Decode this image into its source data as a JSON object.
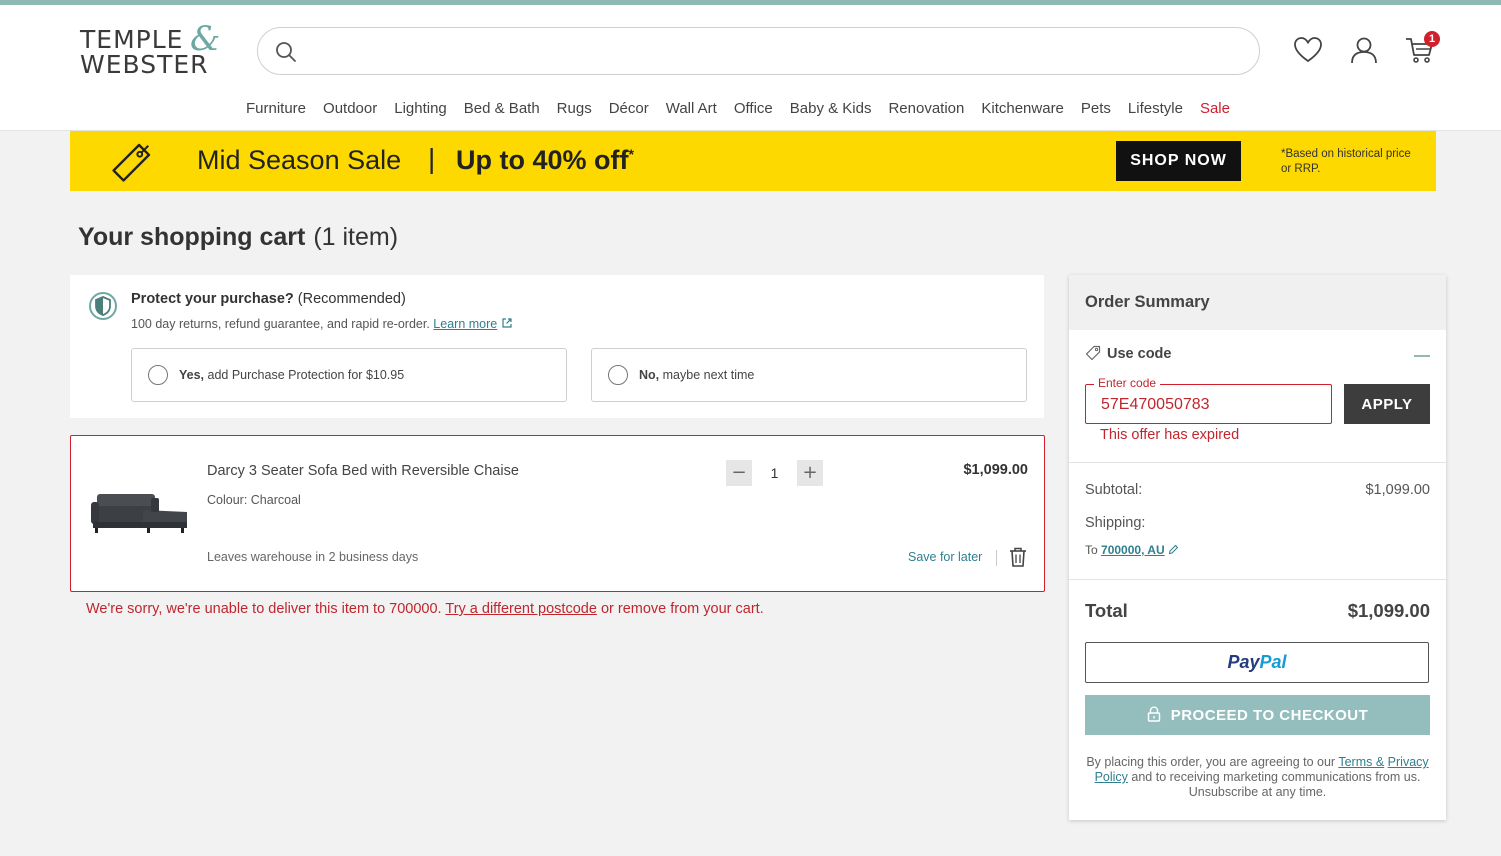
{
  "brand": {
    "line1": "TEMPLE",
    "ampersand": "&",
    "line2": "WEBSTER"
  },
  "search": {
    "placeholder": "",
    "value": ""
  },
  "header_icons": [
    "search-icon",
    "heart-icon",
    "user-icon",
    "cart-icon"
  ],
  "cart_badge": "1",
  "nav": [
    "Furniture",
    "Outdoor",
    "Lighting",
    "Bed & Bath",
    "Rugs",
    "Décor",
    "Wall Art",
    "Office",
    "Baby & Kids",
    "Renovation",
    "Kitchenware",
    "Pets",
    "Lifestyle",
    "Sale"
  ],
  "promo": {
    "title": "Mid Season Sale",
    "separator": "|",
    "offer": "Up to 40% off",
    "offer_mark": "*",
    "button": "SHOP NOW",
    "note": "*Based on historical price or RRP."
  },
  "cart": {
    "title": "Your shopping cart",
    "count": "(1 item)"
  },
  "protection": {
    "title": "Protect your purchase?",
    "recommended": "(Recommended)",
    "description": "100 day returns, refund guarantee, and rapid re-order.",
    "learn_more": "Learn more",
    "yes_bold": "Yes,",
    "yes_rest": "add Purchase Protection for $10.95",
    "no_bold": "No,",
    "no_rest": "maybe next time"
  },
  "item": {
    "name": "Darcy 3 Seater Sofa Bed with Reversible Chaise",
    "colour": "Colour: Charcoal",
    "shipping": "Leaves warehouse in 2 business days",
    "quantity": "1",
    "minus": "−",
    "plus": "+",
    "price": "$1,099.00",
    "save_later": "Save for later"
  },
  "delivery_error": {
    "before": "We're sorry, we're unable to deliver this item to 700000.",
    "link": "Try a different postcode",
    "after": "or remove from your cart."
  },
  "summary": {
    "title": "Order Summary",
    "use_code": "Use code",
    "code_label": "Enter code",
    "code_value": "57E470050783",
    "apply": "APPLY",
    "code_error": "This offer has expired",
    "subtotal_label": "Subtotal:",
    "subtotal_value": "$1,099.00",
    "shipping_label": "Shipping:",
    "ship_to": "To",
    "ship_postcode": "700000, AU",
    "total_label": "Total",
    "total_value": "$1,099.00",
    "paypal_a": "Pay",
    "paypal_b": "Pal",
    "checkout": "PROCEED TO CHECKOUT",
    "legal_a": "By placing this order, you are agreeing to our",
    "legal_link_1": "Terms &",
    "legal_link_2": "Privacy Policy",
    "legal_b": "and to receiving marketing communications from us. Unsubscribe at any time."
  },
  "colors": {
    "accent": "#8fb9b5",
    "error": "#c0262d",
    "promo_bg": "#fdd900",
    "sale": "#d0202e"
  }
}
